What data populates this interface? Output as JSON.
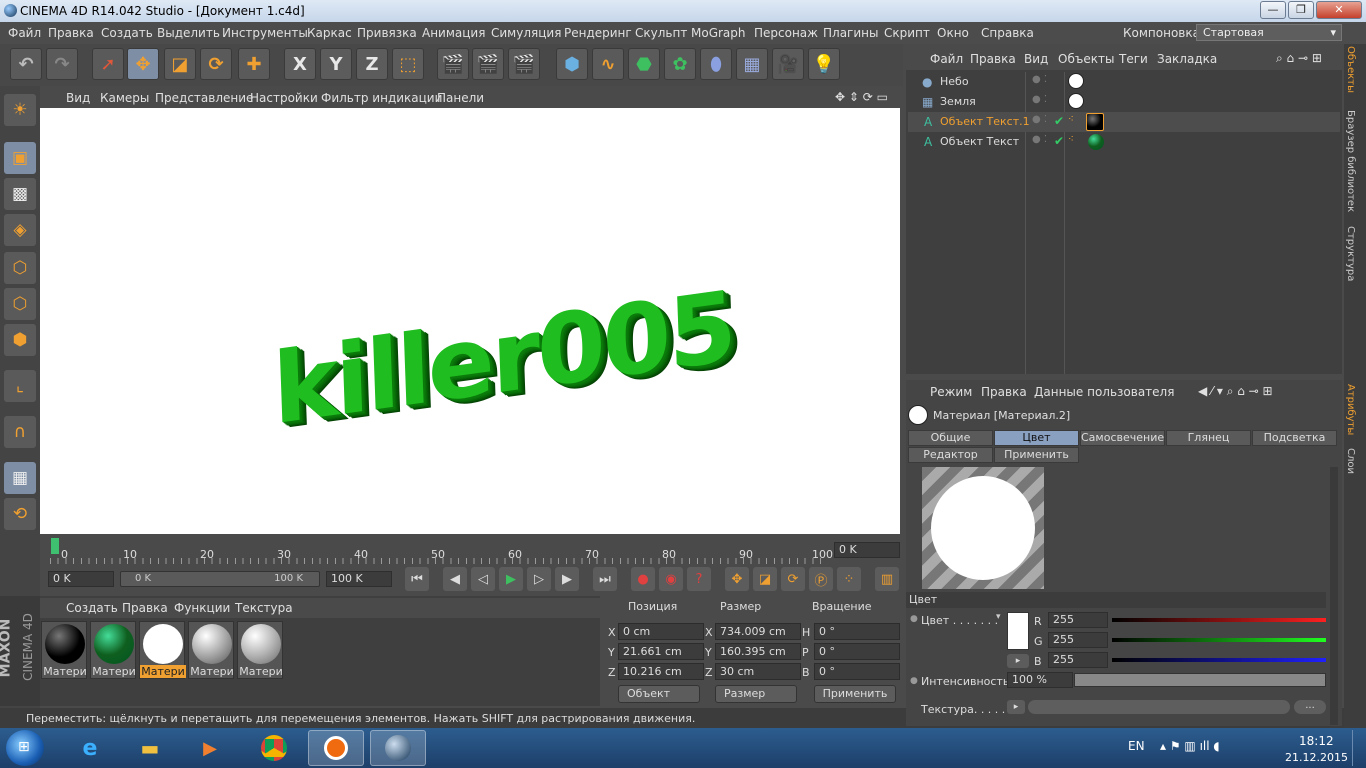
{
  "window": {
    "title": "CINEMA 4D R14.042 Studio - [Документ 1.c4d]",
    "buttons": [
      "—",
      "❐",
      "✕"
    ]
  },
  "menu": {
    "items": [
      "Файл",
      "Правка",
      "Создать",
      "Выделить",
      "Инструменты",
      "Каркас",
      "Привязка",
      "Анимация",
      "Симуляция",
      "Рендеринг",
      "Скульпт",
      "MoGraph",
      "Персонаж",
      "Плагины",
      "Скрипт",
      "Окно",
      "Справка"
    ],
    "layout_label": "Компоновка",
    "layout_value": "Стартовая"
  },
  "toolbar": {
    "axis_x": "X",
    "axis_y": "Y",
    "axis_z": "Z"
  },
  "viewport": {
    "menu": [
      "Вид",
      "Камеры",
      "Представление",
      "Настройки",
      "Фильтр индикации",
      "Панели"
    ],
    "text": "killer005"
  },
  "timeline": {
    "ticks": [
      "0",
      "10",
      "20",
      "30",
      "40",
      "50",
      "60",
      "70",
      "80",
      "90",
      "100"
    ],
    "current_frame": "0 K",
    "start": "0 K",
    "range_start": "0 K",
    "range_end": "100 K",
    "end": "100 K"
  },
  "materials": {
    "menu": [
      "Создать",
      "Правка",
      "Функции",
      "Текстура"
    ],
    "items": [
      {
        "label": "Матери",
        "color": "#000000"
      },
      {
        "label": "Матери",
        "color": "#0f5f1f"
      },
      {
        "label": "Матери",
        "color": "#ffffff"
      },
      {
        "label": "Матери",
        "color": "#aaaaaa"
      },
      {
        "label": "Матери",
        "color": "#b5b5b5"
      }
    ]
  },
  "coords": {
    "headers": [
      "Позиция",
      "Размер",
      "Вращение"
    ],
    "rows": [
      {
        "axis": "X",
        "pos": "0 cm",
        "size_axis": "X",
        "size": "734.009 cm",
        "rot_axis": "H",
        "rot": "0 °"
      },
      {
        "axis": "Y",
        "pos": "21.661 cm",
        "size_axis": "Y",
        "size": "160.395 cm",
        "rot_axis": "P",
        "rot": "0 °"
      },
      {
        "axis": "Z",
        "pos": "10.216 cm",
        "size_axis": "Z",
        "size": "30 cm",
        "rot_axis": "B",
        "rot": "0 °"
      }
    ],
    "mode": "Объект",
    "size_mode": "Размер",
    "apply": "Применить"
  },
  "objects": {
    "menu": [
      "Файл",
      "Правка",
      "Вид",
      "Объекты",
      "Теги",
      "Закладка"
    ],
    "items": [
      {
        "name": "Небо",
        "selected": false
      },
      {
        "name": "Земля",
        "selected": false
      },
      {
        "name": "Объект Текст.1",
        "selected": true
      },
      {
        "name": "Объект Текст",
        "selected": false
      }
    ]
  },
  "attributes": {
    "menu": [
      "Режим",
      "Правка",
      "Данные пользователя"
    ],
    "title": "Материал [Материал.2]",
    "tabs_row1": [
      "Общие",
      "Цвет",
      "Самосвечение",
      "Глянец",
      "Подсветка"
    ],
    "tabs_row2": [
      "Редактор",
      "Применить"
    ],
    "active_tab": "Цвет",
    "section": "Цвет",
    "color_label": "Цвет . . . . . . .",
    "r_label": "R",
    "r": "255",
    "g_label": "G",
    "g": "255",
    "b_label": "B",
    "b": "255",
    "intensity_label": "Интенсивность",
    "intensity": "100 %",
    "texture_label": "Текстура. . . . . .",
    "texture_btn": "..."
  },
  "side_tabs": [
    "Объекты",
    "Браузер библиотек",
    "Структура",
    "Атрибуты",
    "Слои"
  ],
  "brand": {
    "maxon": "MAXON",
    "product": "CINEMA 4D"
  },
  "status": "Переместить: щёлкнуть и перетащить для перемещения элементов. Нажать SHIFT для растрирования движения.",
  "taskbar": {
    "lang": "EN",
    "time": "18:12",
    "date": "21.12.2015"
  }
}
